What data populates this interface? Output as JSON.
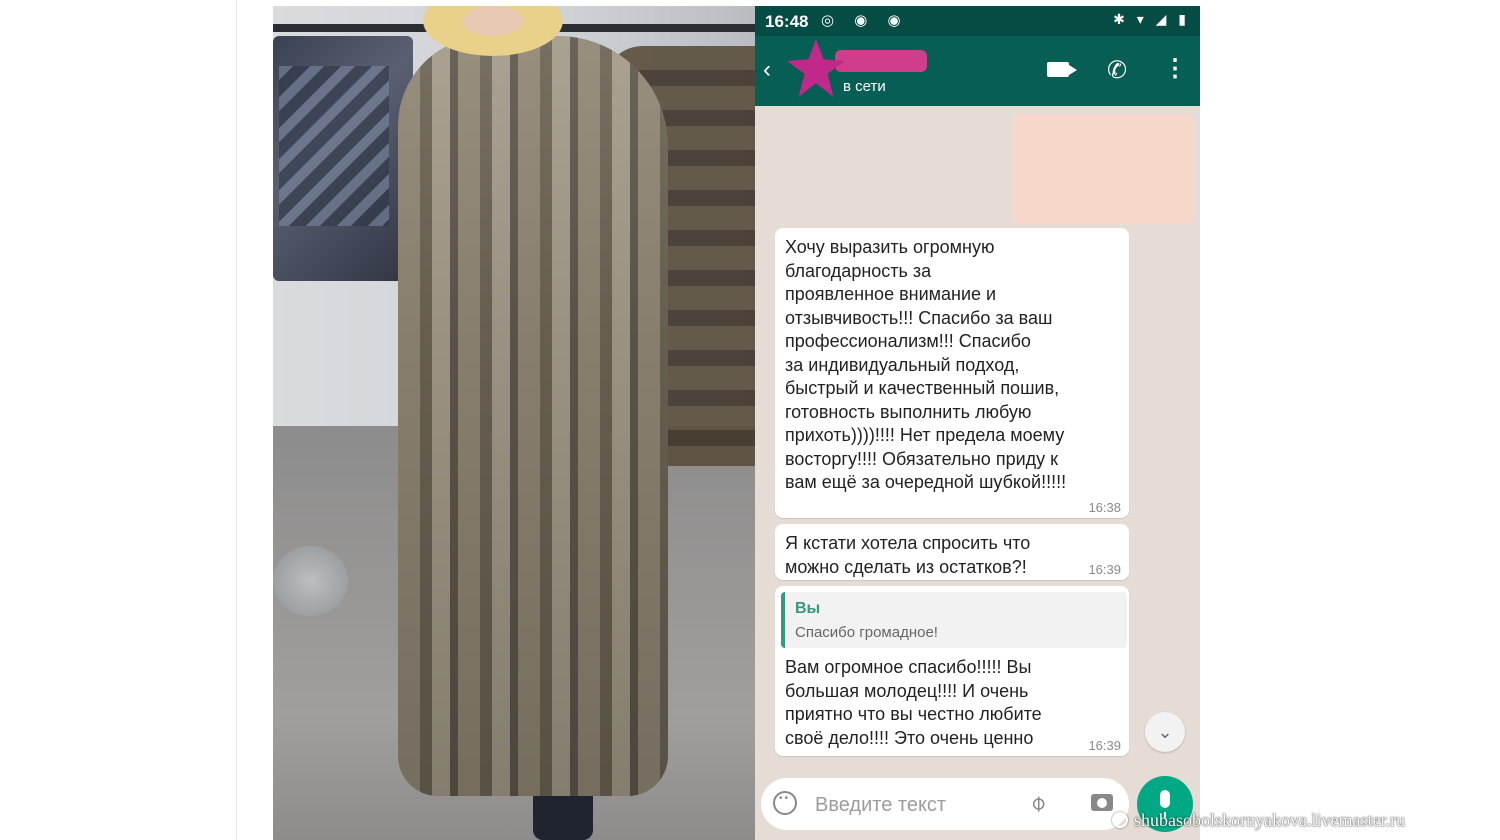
{
  "status": {
    "time": "16:48",
    "apps": "◎ ◉ ◉",
    "system": "✱ ▾ ◢ ▮"
  },
  "contact": {
    "presence": "в сети"
  },
  "messages": [
    {
      "text": "Хочу выразить огромную\nблагодарность за\nпроявленное внимание и\nотзывчивость!!! Спасибо за ваш\nпрофессионализм!!! Спасибо\nза индивидуальный подход,\nбыстрый и качественный пошив,\nготовность выполнить любую\nприхоть))))!!!! Нет предела моему\nвосторгу!!!! Обязательно приду к\nвам ещё за очередной шубкой!!!!!",
      "time": "16:38"
    },
    {
      "text": "Я кстати хотела спросить что\nможно сделать из остатков?!",
      "time": "16:39"
    },
    {
      "quote_author": "Вы",
      "quote_text": "Спасибо громадное!",
      "text": "Вам огромное спасибо!!!!! Вы\nбольшая молодец!!!! И очень\nприятно что вы честно любите\nсвоё дело!!!! Это очень ценно",
      "time": "16:39"
    }
  ],
  "composer": {
    "placeholder": "Введите текст"
  },
  "watermark": "shubasobolskornyakova.livemaster.ru",
  "colors": {
    "header": "#075e54",
    "accent": "#00a884",
    "chat_bg": "#e5ddd5"
  }
}
